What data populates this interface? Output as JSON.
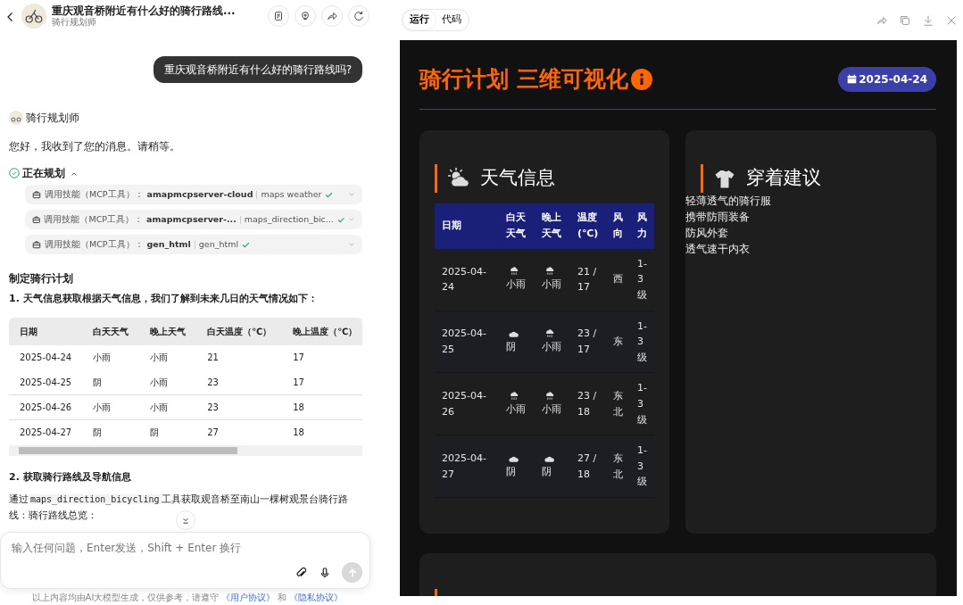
{
  "chat": {
    "title": "重庆观音桥附近有什么好的骑行路线...",
    "subtitle": "骑行规划师",
    "user_message": "重庆观音桥附近有什么好的骑行路线吗?",
    "agent_name": "骑行规划师",
    "greeting": "您好，我收到了您的消息。请稍等。",
    "status": {
      "label": "正在规划",
      "expanded": true
    },
    "tool_calls": [
      {
        "label": "调用技能（MCP工具）：",
        "server": "amapmcpserver-cloud",
        "tool": "maps weather"
      },
      {
        "label": "调用技能（MCP工具）：",
        "server": "amapmcpserver-...",
        "tool": "maps_direction_bic..."
      },
      {
        "label": "调用技能（MCP工具）：",
        "server": "gen_html",
        "tool": "gen_html"
      }
    ],
    "section_title": "制定骑行计划",
    "step1": "1. 天气信息获取根据天气信息，我们了解到未来几日的天气情况如下：",
    "table": {
      "columns": [
        "日期",
        "白天天气",
        "晚上天气",
        "白天温度（℃）",
        "晚上温度（℃）"
      ],
      "rows": [
        [
          "2025-04-24",
          "小雨",
          "小雨",
          "21",
          "17"
        ],
        [
          "2025-04-25",
          "阴",
          "小雨",
          "23",
          "17"
        ],
        [
          "2025-04-26",
          "小雨",
          "小雨",
          "23",
          "18"
        ],
        [
          "2025-04-27",
          "阴",
          "阴",
          "27",
          "18"
        ]
      ]
    },
    "step2": "2. 获取骑行路线及导航信息",
    "para_before": "通过",
    "code": "maps_direction_bicycling",
    "para_after": "工具获取观音桥至南山一棵树观景台骑行路线：骑行路线总览：",
    "input": {
      "placeholder": "输入任何问题，Enter发送，Shift + Enter 换行"
    },
    "footer": {
      "text": "以上内容均由AI大模型生成，仅供参考，请遵守",
      "link1": "《用户协议》",
      "joiner": "和",
      "link2": "《隐私协议》"
    }
  },
  "preview": {
    "tabs": [
      {
        "label": "运行",
        "selected": true
      },
      {
        "label": "代码",
        "selected": false
      }
    ],
    "title": "骑行计划 三维可视化",
    "date": "2025-04-24",
    "weather": {
      "title": "天气信息",
      "columns": [
        "日期",
        "白天天气",
        "晚上天气",
        "温度(℃)",
        "风向",
        "风力"
      ],
      "rows": [
        {
          "date": "2025-04-24",
          "day": {
            "kind": "rain",
            "text": "小雨"
          },
          "night": {
            "kind": "rain",
            "text": "小雨"
          },
          "temp": "21 / 17",
          "wind_dir": "西",
          "wind_power": "1-3级"
        },
        {
          "date": "2025-04-25",
          "day": {
            "kind": "cloudy",
            "text": "阴"
          },
          "night": {
            "kind": "rain",
            "text": "小雨"
          },
          "temp": "23 / 17",
          "wind_dir": "东",
          "wind_power": "1-3级"
        },
        {
          "date": "2025-04-26",
          "day": {
            "kind": "rain",
            "text": "小雨"
          },
          "night": {
            "kind": "rain",
            "text": "小雨"
          },
          "temp": "23 / 18",
          "wind_dir": "东北",
          "wind_power": "1-3级"
        },
        {
          "date": "2025-04-27",
          "day": {
            "kind": "cloudy",
            "text": "阴"
          },
          "night": {
            "kind": "cloudy",
            "text": "阴"
          },
          "temp": "27 / 18",
          "wind_dir": "东北",
          "wind_power": "1-3级"
        }
      ]
    },
    "clothing": {
      "title": "穿着建议",
      "items": [
        "轻薄透气的骑行服",
        "携带防雨装备",
        "防风外套",
        "透气速干内衣"
      ]
    }
  }
}
